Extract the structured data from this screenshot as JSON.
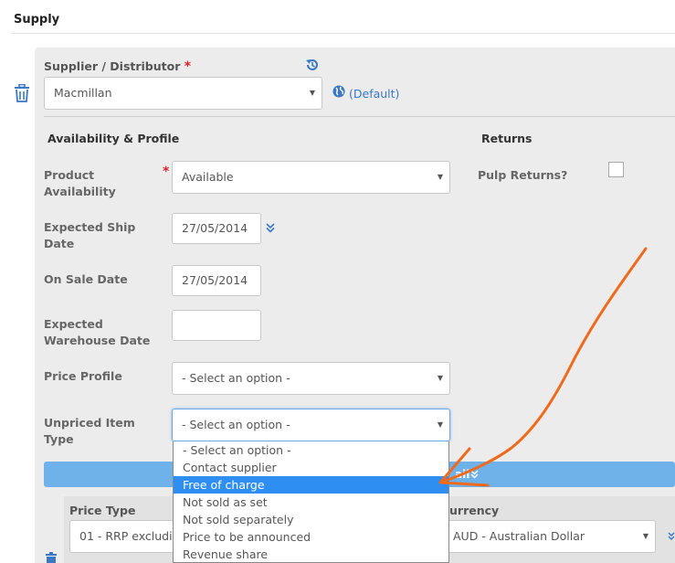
{
  "section": {
    "title": "Supply"
  },
  "supplier": {
    "label": "Supplier / Distributor",
    "required_mark": "*",
    "value": "Macmillan",
    "default_link": "(Default)"
  },
  "availability": {
    "heading": "Availability & Profile",
    "product_availability": {
      "label_line1": "Product",
      "label_line2": "Availability",
      "required_mark": "*",
      "value": "Available"
    },
    "expected_ship_date": {
      "label_line1": "Expected Ship",
      "label_line2": "Date",
      "value": "27/05/2014"
    },
    "on_sale_date": {
      "label": "On Sale Date",
      "value": "27/05/2014"
    },
    "expected_warehouse_date": {
      "label_line1": "Expected",
      "label_line2": "Warehouse Date",
      "value": ""
    },
    "price_profile": {
      "label": "Price Profile",
      "value": "- Select an option -"
    },
    "unpriced_item_type": {
      "label_line1": "Unpriced Item",
      "label_line2": "Type",
      "value": "- Select an option -",
      "options": [
        "- Select an option -",
        "Contact supplier",
        "Free of charge",
        "Not sold as set",
        "Not sold separately",
        "Price to be announced",
        "Revenue share"
      ],
      "highlighted_index": 2
    }
  },
  "returns": {
    "heading": "Returns",
    "pulp_returns_label": "Pulp Returns?",
    "pulp_returns_checked": false
  },
  "prices": {
    "bar_label_partial": "ail",
    "price_type_label": "Price Type",
    "price_type_value": "01 - RRP excludir",
    "currency_label_partial": "urrency",
    "currency_value": "AUD - Australian Dollar"
  },
  "colors": {
    "accent": "#3a78c3",
    "highlight": "#2f8ef1",
    "annotation": "#f06a1c",
    "required": "#d9232d"
  },
  "icons": {
    "trash": "trash-icon",
    "history": "history-icon",
    "globe": "globe-icon",
    "chevron": "double-chevron-down-icon"
  }
}
